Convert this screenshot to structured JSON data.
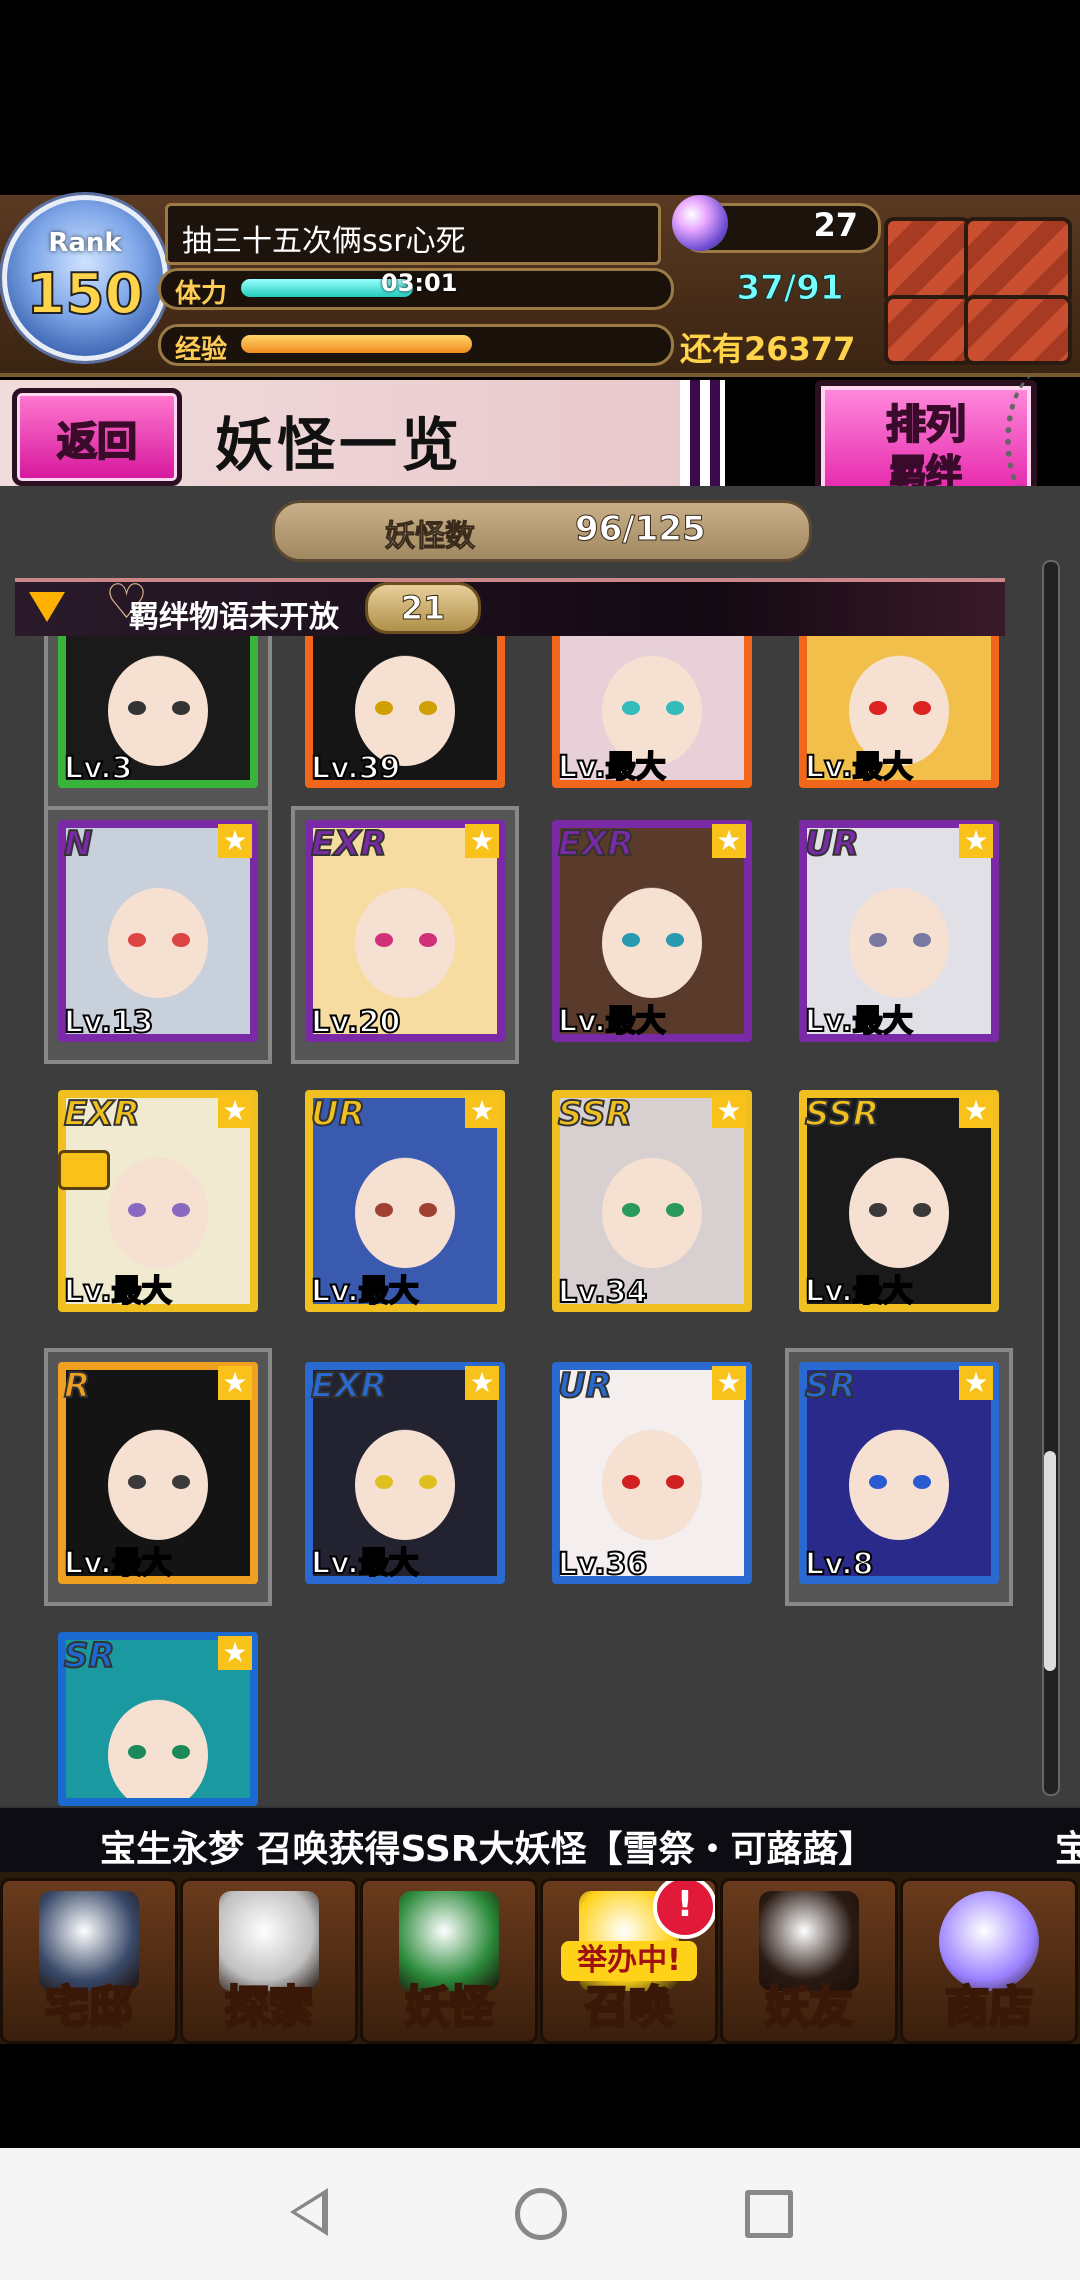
{
  "status": {
    "rank_label": "Rank",
    "rank_value": "150",
    "player_name": "抽三十五次俩ssr心死",
    "stamina_label": "体力",
    "stamina_timer": "03:01",
    "stamina_count": "37/91",
    "stamina_fraction": 0.41,
    "exp_label": "经验",
    "exp_fraction": 0.55,
    "exp_remaining": "还有26377",
    "gem_count": "27"
  },
  "header": {
    "back_label": "返回",
    "title": "妖怪一览",
    "sort_label_top": "排列",
    "sort_label_bottom": "羁绊"
  },
  "monster_count": {
    "label": "妖怪数",
    "value": "96/125"
  },
  "category": {
    "label": "羁绊物语未开放",
    "count": "21"
  },
  "cards": [
    {
      "rarity": "",
      "level": "Lv.3",
      "frame": "#36b53a",
      "hair": "#1a1a1a",
      "eye": "#333",
      "selected": true
    },
    {
      "rarity": "",
      "level": "Lv.39",
      "frame": "#f0661a",
      "hair": "#151515",
      "eye": "#d0a000",
      "selected": false
    },
    {
      "rarity": "",
      "level": "Lv.最大",
      "frame": "#f0661a",
      "hair": "#e8d0d8",
      "eye": "#3bb",
      "selected": false
    },
    {
      "rarity": "",
      "level": "Lv.最大",
      "frame": "#f0661a",
      "hair": "#f2c04a",
      "eye": "#d22",
      "selected": false
    },
    {
      "rarity": "N",
      "level": "Lv.13",
      "frame": "#7a2aa6",
      "hair": "#c8d0dc",
      "eye": "#d44",
      "selected": true
    },
    {
      "rarity": "EXR",
      "level": "Lv.20",
      "frame": "#7a2aa6",
      "hair": "#f6dca0",
      "eye": "#d0307a",
      "selected": true
    },
    {
      "rarity": "EXR",
      "level": "Lv.最大",
      "frame": "#7a2aa6",
      "hair": "#5a3a2a",
      "eye": "#2a9ab0",
      "selected": false
    },
    {
      "rarity": "UR",
      "level": "Lv.最大",
      "frame": "#7a2aa6",
      "hair": "#e0e0e6",
      "eye": "#7a7aa0",
      "selected": false
    },
    {
      "rarity": "EXR",
      "level": "Lv.最大",
      "frame": "#f0c020",
      "hair": "#f0ead0",
      "eye": "#8a6ac0",
      "selected": false
    },
    {
      "rarity": "UR",
      "level": "Lv.最大",
      "frame": "#f0c020",
      "hair": "#3a5ab0",
      "eye": "#a04030",
      "selected": false
    },
    {
      "rarity": "SSR",
      "level": "Lv.34",
      "frame": "#f0c020",
      "hair": "#d8d0d0",
      "eye": "#2a9a5a",
      "selected": false
    },
    {
      "rarity": "SSR",
      "level": "Lv.最大",
      "frame": "#f0c020",
      "hair": "#1a1a1a",
      "eye": "#3a3a3a",
      "selected": false
    },
    {
      "rarity": "R",
      "level": "Lv.最大",
      "frame": "#f0a020",
      "hair": "#141414",
      "eye": "#3a3a3a",
      "selected": true
    },
    {
      "rarity": "EXR",
      "level": "Lv.最大",
      "frame": "#2a6ad0",
      "hair": "#222230",
      "eye": "#e0c020",
      "selected": false
    },
    {
      "rarity": "UR",
      "level": "Lv.36",
      "frame": "#2a6ad0",
      "hair": "#f4eeee",
      "eye": "#d02020",
      "selected": false
    },
    {
      "rarity": "SR",
      "level": "Lv.8",
      "frame": "#2a6ad0",
      "hair": "#2a2a8a",
      "eye": "#2a5ad0",
      "selected": true
    },
    {
      "rarity": "SR",
      "level": "",
      "frame": "#1a6ad0",
      "hair": "#1a9aa0",
      "eye": "#1a8a5a",
      "selected": false
    }
  ],
  "scrollbar": {
    "position": 0.88
  },
  "ticker": {
    "text": "宝生永梦 召唤获得SSR大妖怪【雪祭・可蕗蕗】",
    "text_next": "宝"
  },
  "nav": {
    "items": [
      {
        "label": "宅邸",
        "icon": "mansion-icon"
      },
      {
        "label": "探索",
        "icon": "magnifier-icon"
      },
      {
        "label": "妖怪",
        "icon": "scroll-icon"
      },
      {
        "label": "召唤",
        "icon": "summon-icon",
        "badge": "!",
        "event": "举办中!"
      },
      {
        "label": "妖友",
        "icon": "friend-icon"
      },
      {
        "label": "商店",
        "icon": "shop-orb-icon"
      }
    ]
  }
}
